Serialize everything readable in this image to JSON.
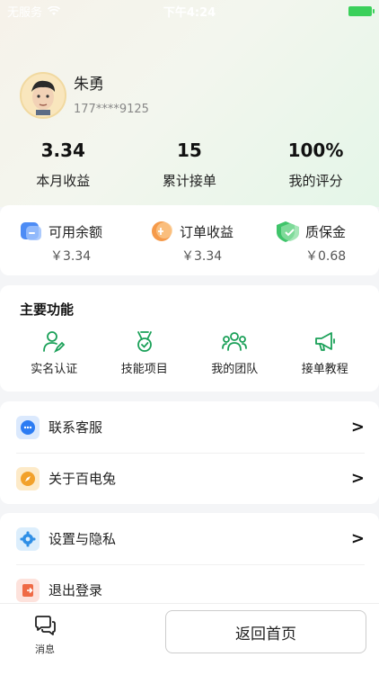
{
  "status_bar": {
    "carrier": "无服务",
    "time": "下午4:24"
  },
  "profile": {
    "name": "朱勇",
    "phone": "177****9125"
  },
  "stats": [
    {
      "value": "3.34",
      "label": "本月收益"
    },
    {
      "value": "15",
      "label": "累计接单"
    },
    {
      "value": "100%",
      "label": "我的评分"
    }
  ],
  "wallet": [
    {
      "label": "可用余额",
      "amount": "￥3.34",
      "icon": "wallet-icon"
    },
    {
      "label": "订单收益",
      "amount": "￥3.34",
      "icon": "coin-icon"
    },
    {
      "label": "质保金",
      "amount": "￥0.68",
      "icon": "shield-icon"
    }
  ],
  "functions": {
    "title": "主要功能",
    "items": [
      {
        "label": "实名认证",
        "icon": "user-edit-icon"
      },
      {
        "label": "技能项目",
        "icon": "medal-icon"
      },
      {
        "label": "我的团队",
        "icon": "team-icon"
      },
      {
        "label": "接单教程",
        "icon": "megaphone-icon"
      }
    ]
  },
  "menu_group_1": [
    {
      "label": "联系客服",
      "icon": "chat-icon",
      "arrow": ">"
    },
    {
      "label": "关于百电兔",
      "icon": "compass-icon",
      "arrow": ">"
    }
  ],
  "menu_group_2": [
    {
      "label": "设置与隐私",
      "icon": "gear-icon",
      "arrow": ">"
    },
    {
      "label": "退出登录",
      "icon": "logout-icon"
    }
  ],
  "bottom_bar": {
    "message_label": "消息",
    "home_button": "返回首页"
  },
  "colors": {
    "accent_green": "#1aa058",
    "battery": "#3ad05a"
  }
}
